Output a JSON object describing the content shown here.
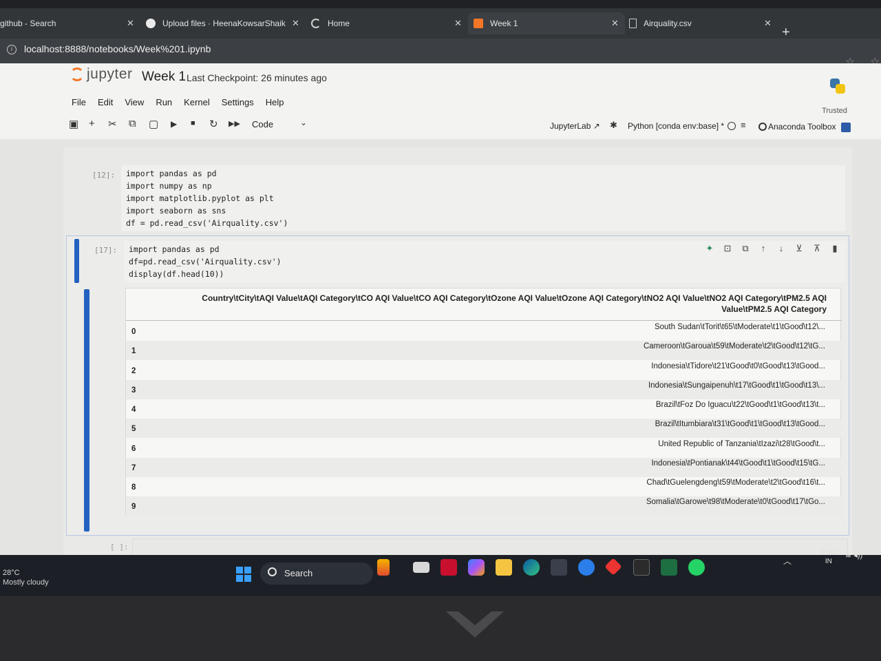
{
  "browser": {
    "tabs": [
      {
        "label": "github - Search"
      },
      {
        "label": "Upload files · HeenaKowsarShaik"
      },
      {
        "label": "Home"
      },
      {
        "label": "Week 1"
      },
      {
        "label": "Airquality.csv"
      }
    ],
    "url": "localhost:8888/notebooks/Week%201.ipynb"
  },
  "jupyter": {
    "logo_text": "jupyter",
    "notebook_title": "Week 1",
    "checkpoint": "Last Checkpoint: 26 minutes ago",
    "menu": [
      "File",
      "Edit",
      "View",
      "Run",
      "Kernel",
      "Settings",
      "Help"
    ],
    "trusted": "Trusted",
    "toolbar": {
      "cell_type": "Code",
      "jupyterlab_link": "JupyterLab",
      "kernel": "Python [conda env:base] *",
      "anaconda": "Anaconda Toolbox"
    }
  },
  "cells": {
    "cell1": {
      "prompt": "[12]:",
      "lines": [
        "import pandas as pd",
        "import numpy as np",
        "import matplotlib.pyplot as plt",
        "import seaborn as sns",
        "df = pd.read_csv('Airquality.csv')"
      ]
    },
    "cell2": {
      "prompt": "[17]:",
      "lines": [
        "import pandas as pd",
        "df=pd.read_csv('Airquality.csv')",
        "display(df.head(10))"
      ]
    },
    "cell3": {
      "prompt": "[ ]:"
    }
  },
  "output": {
    "header_line1": "Country\\tCity\\tAQI Value\\tAQI Category\\tCO AQI Value\\tCO AQI Category\\tOzone AQI Value\\tOzone AQI Category\\tNO2 AQI Value\\tNO2 AQI Category\\tPM2.5 AQI",
    "header_line2": "Value\\tPM2.5 AQI Category",
    "rows": [
      {
        "index": "0",
        "value": "South Sudan\\tTorit\\t65\\tModerate\\t1\\tGood\\t12\\..."
      },
      {
        "index": "1",
        "value": "Cameroon\\tGaroua\\t59\\tModerate\\t2\\tGood\\t12\\tG..."
      },
      {
        "index": "2",
        "value": "Indonesia\\tTidore\\t21\\tGood\\t0\\tGood\\t13\\tGood..."
      },
      {
        "index": "3",
        "value": "Indonesia\\tSungaipenuh\\t17\\tGood\\t1\\tGood\\t13\\..."
      },
      {
        "index": "4",
        "value": "Brazil\\tFoz Do Iguacu\\t22\\tGood\\t1\\tGood\\t13\\t..."
      },
      {
        "index": "5",
        "value": "Brazil\\tItumbiara\\t31\\tGood\\t1\\tGood\\t13\\tGood..."
      },
      {
        "index": "6",
        "value": "United Republic of Tanzania\\tIzazi\\t28\\tGood\\t..."
      },
      {
        "index": "7",
        "value": "Indonesia\\tPontianak\\t44\\tGood\\t1\\tGood\\t15\\tG..."
      },
      {
        "index": "8",
        "value": "Chad\\tGuelengdeng\\t59\\tModerate\\t2\\tGood\\t16\\t..."
      },
      {
        "index": "9",
        "value": "Somalia\\tGarowe\\t98\\tModerate\\t0\\tGood\\t17\\tGo..."
      }
    ]
  },
  "taskbar": {
    "temperature": "28°C",
    "weather": "Mostly cloudy",
    "search": "Search",
    "lang1": "ENG",
    "lang2": "IN"
  }
}
